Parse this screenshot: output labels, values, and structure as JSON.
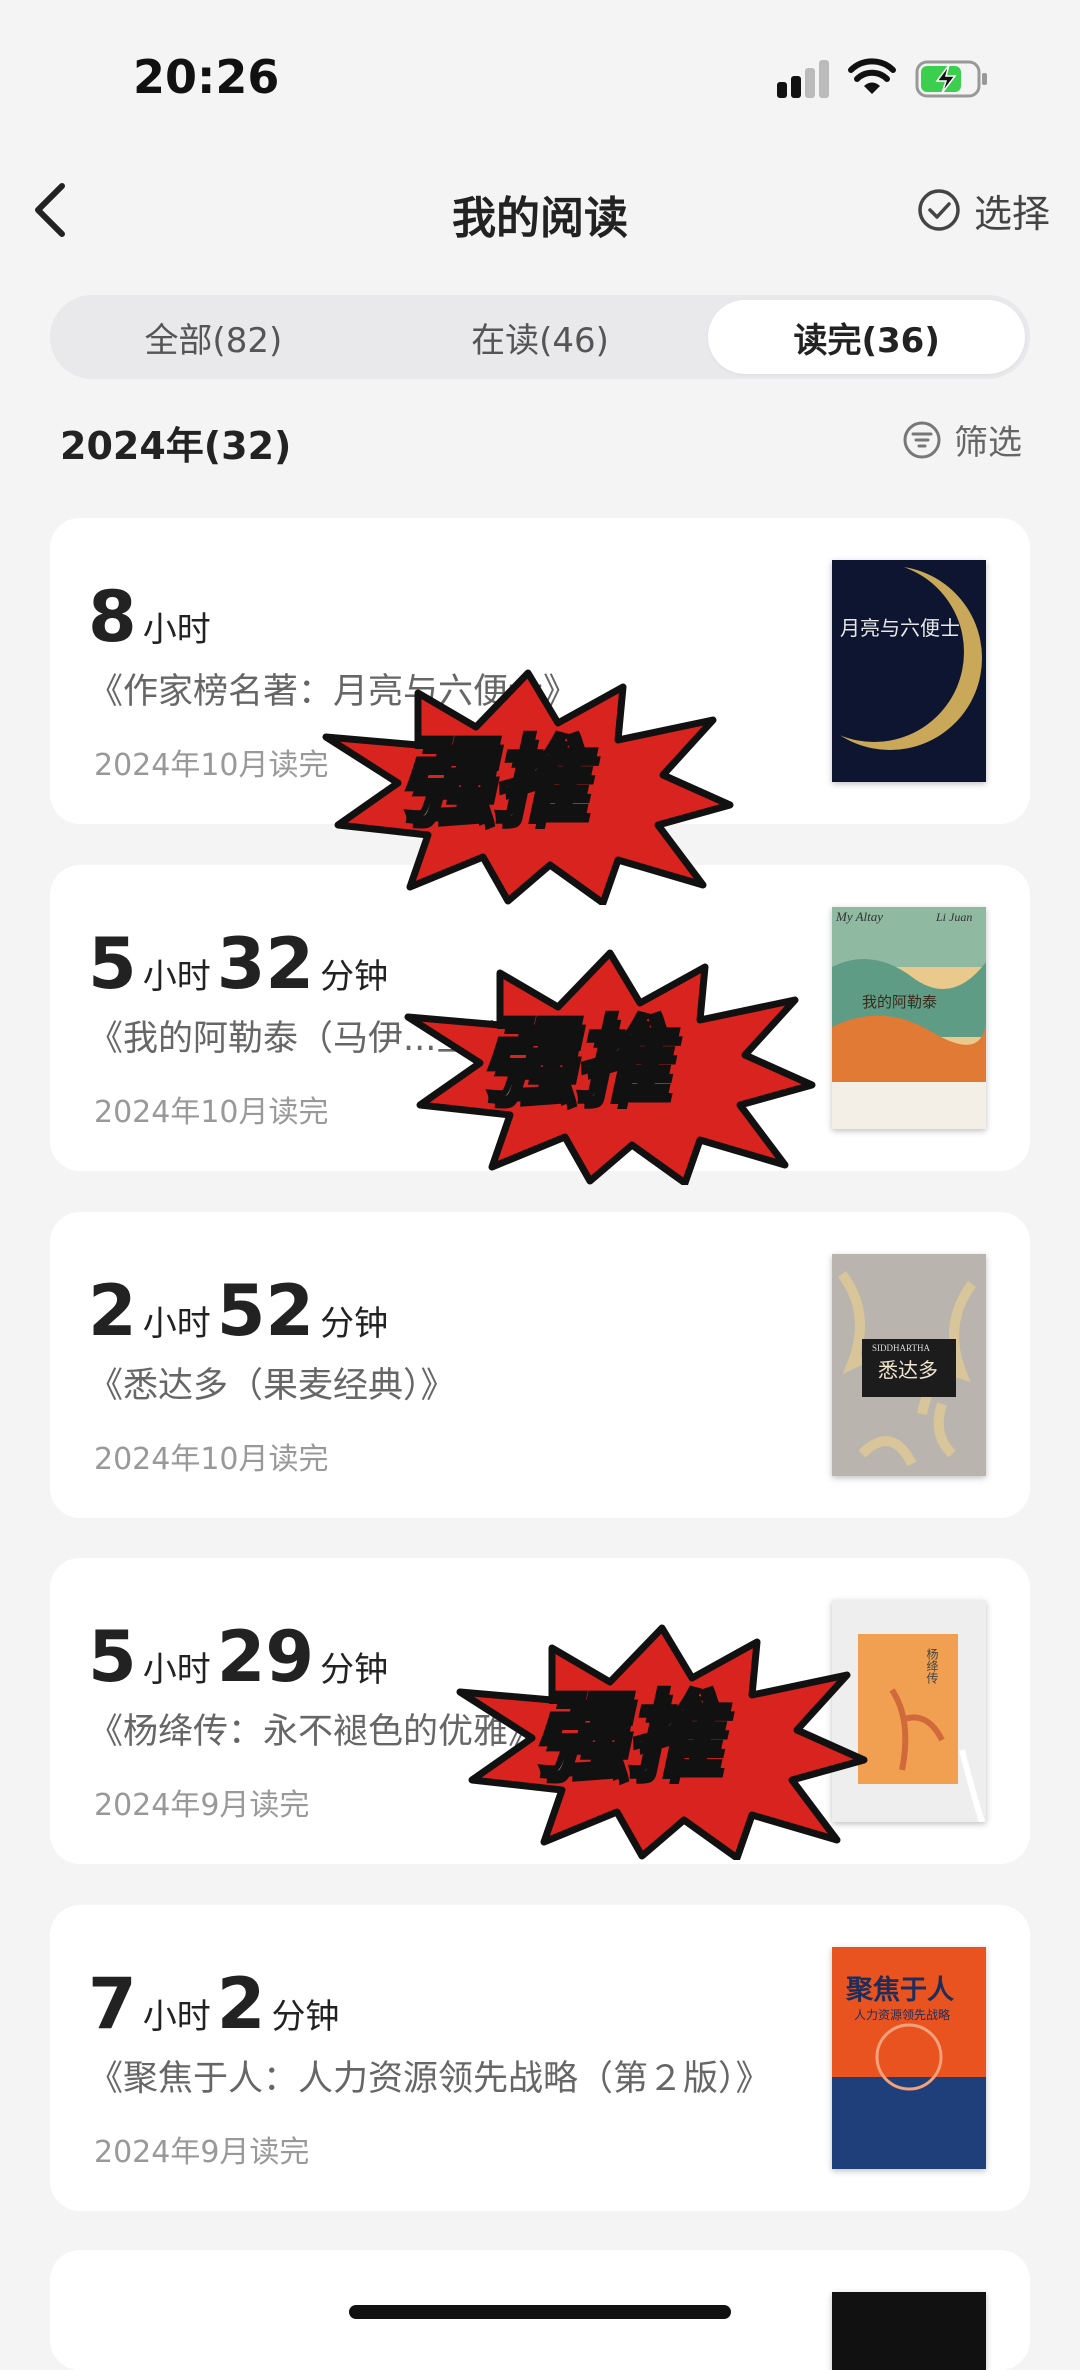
{
  "status_bar": {
    "time": "20:26"
  },
  "header": {
    "title": "我的阅读",
    "select_label": "选择"
  },
  "tabs": [
    {
      "label": "全部(82)",
      "active": false
    },
    {
      "label": "在读(46)",
      "active": false
    },
    {
      "label": "读完(36)",
      "active": true
    }
  ],
  "section": {
    "year_label": "2024年(32)",
    "filter_label": "筛选"
  },
  "books": [
    {
      "hours": "8",
      "hours_unit": "小时",
      "minutes": "",
      "minutes_unit": "",
      "title": "《作家榜名著：月亮与六便士》",
      "date": "2024年10月读完",
      "cover_title": "月亮与六便士"
    },
    {
      "hours": "5",
      "hours_unit": "小时",
      "minutes": "32",
      "minutes_unit": "分钟",
      "title": "《我的阿勒泰（马伊...主演...）》",
      "date": "2024年10月读完",
      "cover_title": "我的阿勒泰",
      "cover_en": "My Altay",
      "cover_author": "Li Juan"
    },
    {
      "hours": "2",
      "hours_unit": "小时",
      "minutes": "52",
      "minutes_unit": "分钟",
      "title": "《悉达多（果麦经典）》",
      "date": "2024年10月读完",
      "cover_title": "悉达多",
      "cover_en": "SIDDHARTHA"
    },
    {
      "hours": "5",
      "hours_unit": "小时",
      "minutes": "29",
      "minutes_unit": "分钟",
      "title": "《杨绛传：永不褪色的优雅》",
      "date": "2024年9月读完",
      "cover_title": "杨绛传"
    },
    {
      "hours": "7",
      "hours_unit": "小时",
      "minutes": "2",
      "minutes_unit": "分钟",
      "title": "《聚焦于人：人力资源领先战略（第２版）》",
      "date": "2024年9月读完",
      "cover_title": "聚焦于人",
      "cover_subtitle": "人力资源领先战略"
    }
  ],
  "stamp_text": "强推",
  "colors": {
    "background": "#f4f4f5",
    "card": "#ffffff",
    "stamp_red": "#d8231f",
    "battery_green": "#3ccf4e"
  }
}
